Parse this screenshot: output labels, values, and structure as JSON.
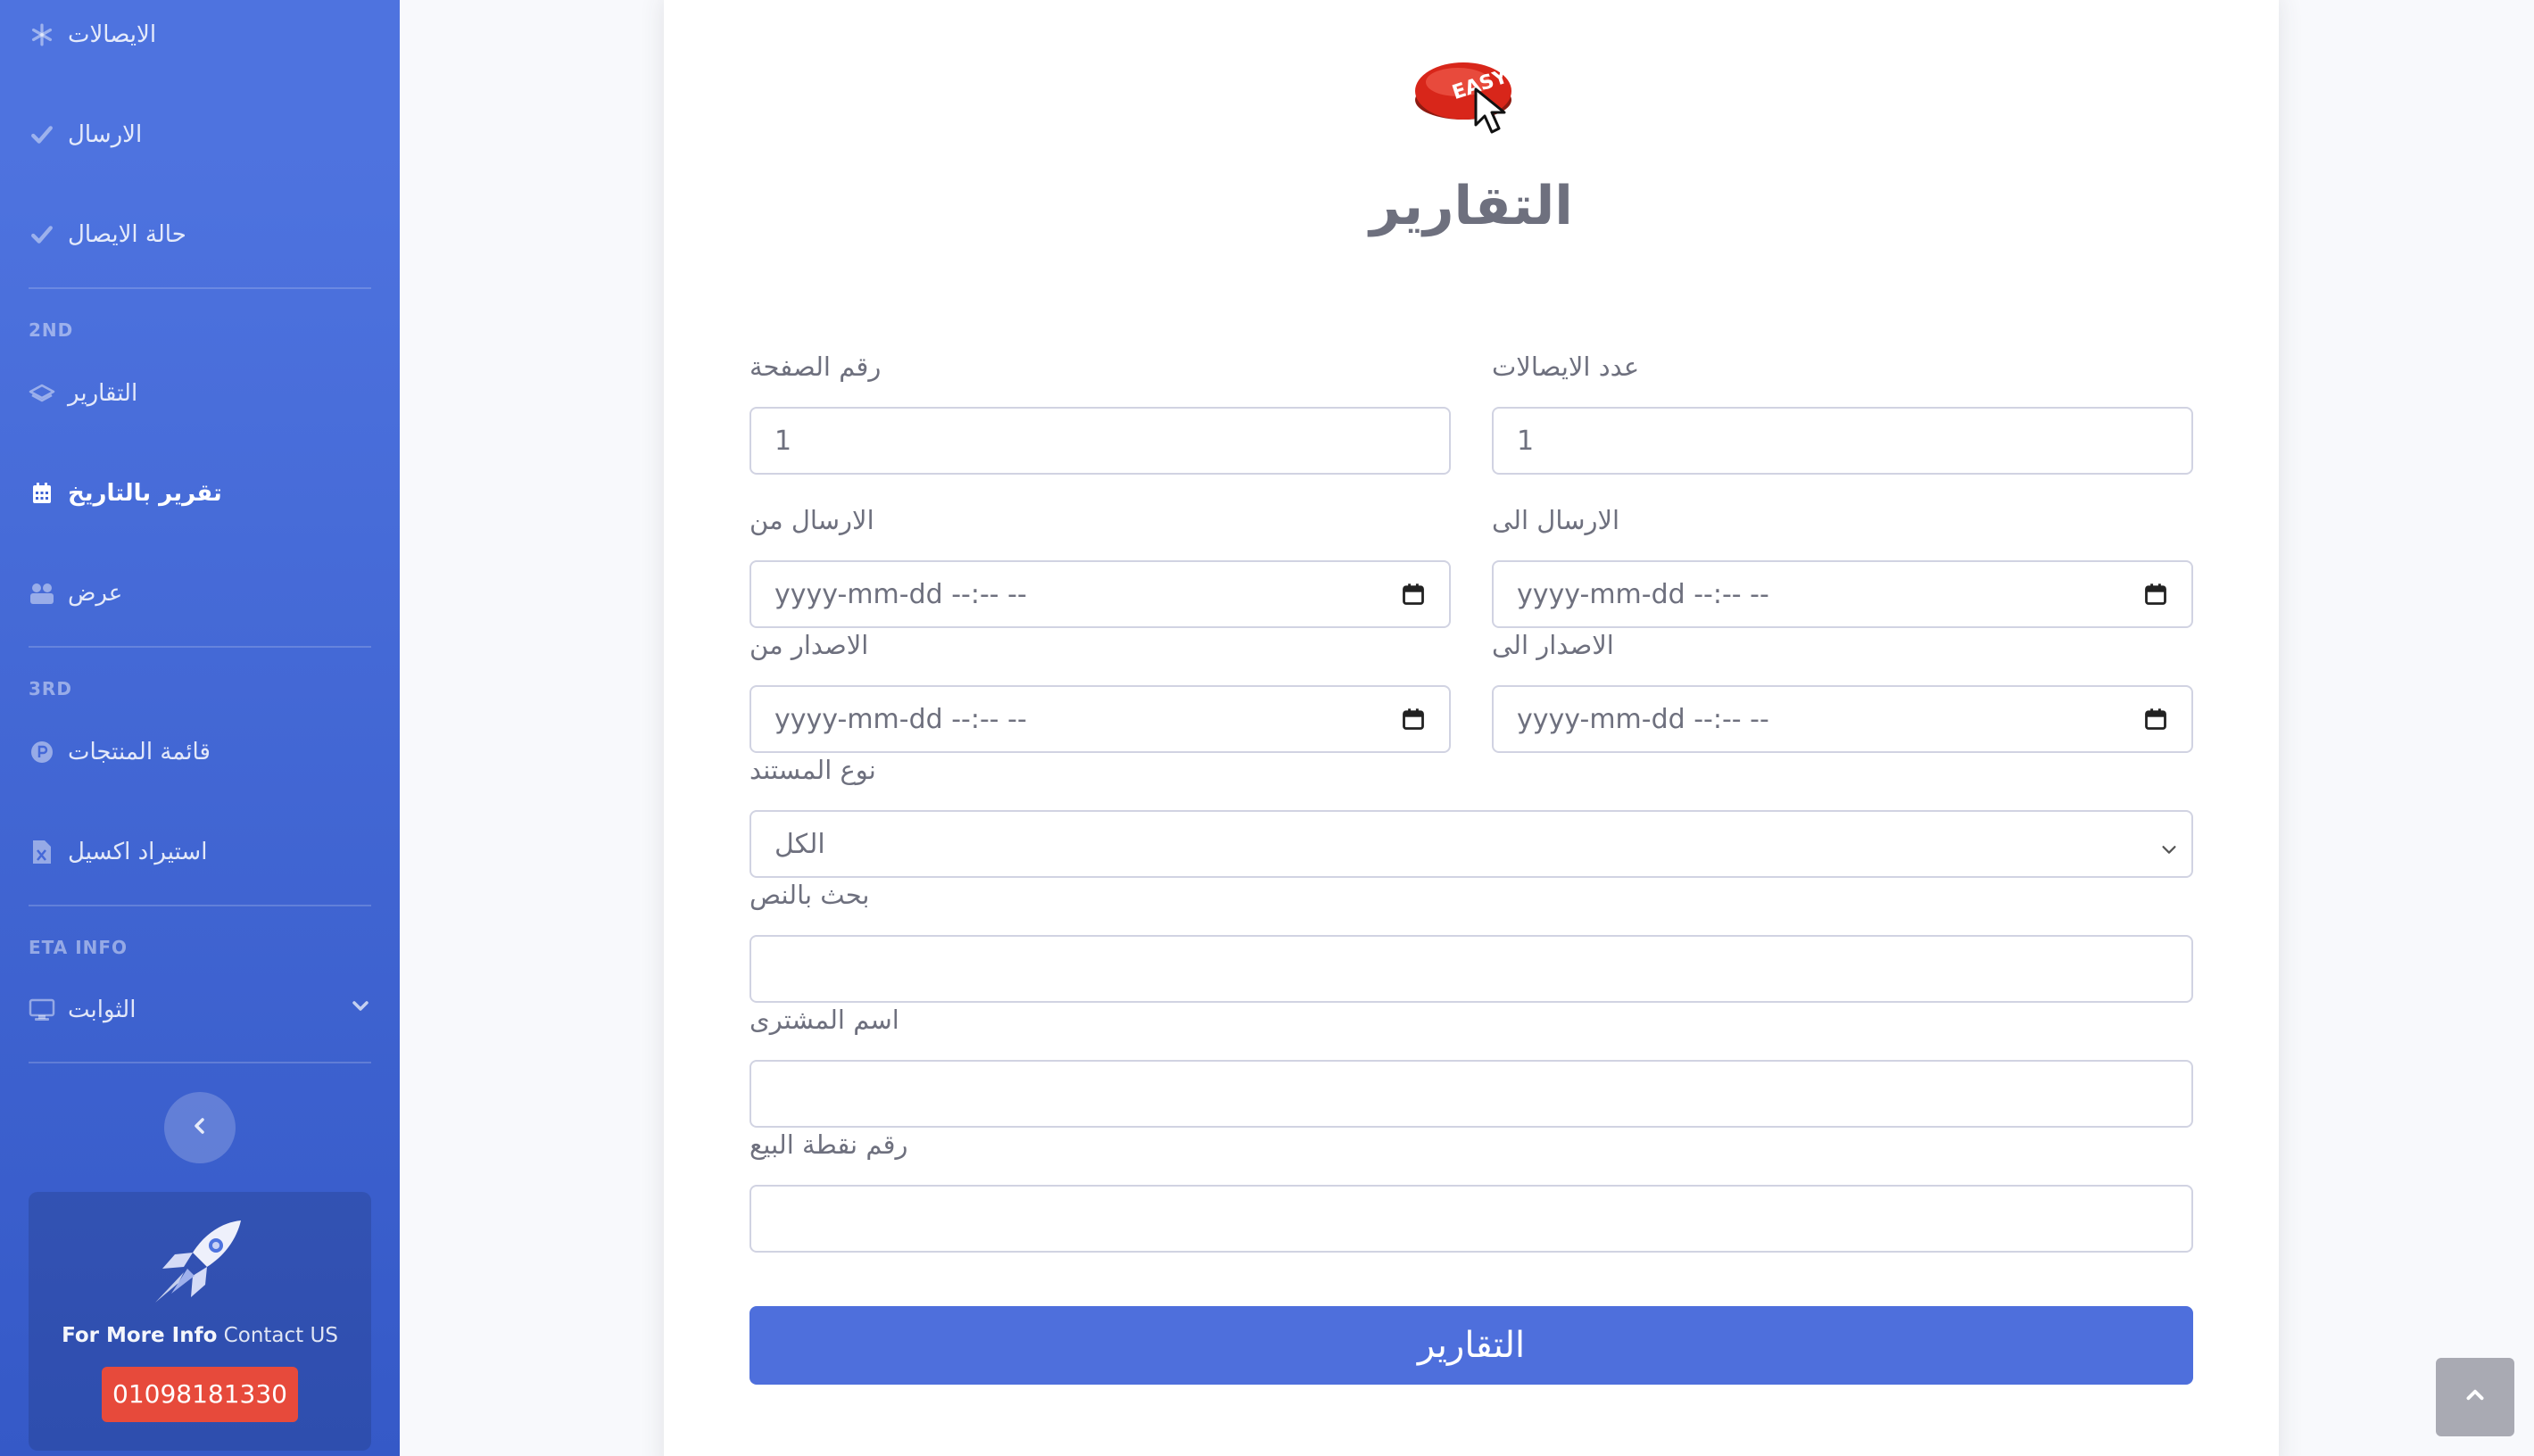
{
  "sidebar": {
    "items": [
      {
        "label": "الايصالات",
        "icon": "asterisk-icon"
      },
      {
        "label": "الارسال",
        "icon": "check-icon"
      },
      {
        "label": "حالة الايصال",
        "icon": "check-icon"
      },
      {
        "label": "التقارير",
        "icon": "layers-icon"
      },
      {
        "label": "تقرير بالتاريخ",
        "icon": "calendar-icon",
        "active": true
      },
      {
        "label": "عرض",
        "icon": "users-icon"
      },
      {
        "label": "قائمة المنتجات",
        "icon": "product-hunt-icon"
      },
      {
        "label": "استيراد اكسيل",
        "icon": "file-excel-icon"
      },
      {
        "label": "الثوابت",
        "icon": "desktop-icon"
      }
    ],
    "headings": [
      "2ND",
      "3RD",
      "ETA INFO"
    ],
    "promo": {
      "bold": "For More Info",
      "text": " Contact US",
      "phone": "01098181330"
    }
  },
  "logo": {
    "text": "EASY"
  },
  "page": {
    "title": "التقارير"
  },
  "form": {
    "receipts_count": {
      "label": "عدد الايصالات",
      "value": "1"
    },
    "page_number": {
      "label": "رقم الصفحة",
      "value": "1"
    },
    "sent_to": {
      "label": "الارسال الى",
      "placeholder": "yyyy-mm-dd --:-- --"
    },
    "sent_from": {
      "label": "الارسال من",
      "placeholder": "yyyy-mm-dd --:-- --"
    },
    "issued_to": {
      "label": "الاصدار الى",
      "placeholder": "yyyy-mm-dd --:-- --"
    },
    "issued_from": {
      "label": "الاصدار من",
      "placeholder": "yyyy-mm-dd --:-- --"
    },
    "doc_type": {
      "label": "نوع المستند",
      "value": "الكل"
    },
    "text_search": {
      "label": "بحث بالنص"
    },
    "buyer_name": {
      "label": "اسم المشترى"
    },
    "pos_number": {
      "label": "رقم نقطة البيع"
    },
    "submit_label": "التقارير"
  },
  "colors": {
    "sidebar": "#4e73df",
    "primary": "#4e6fdc",
    "danger": "#e74a3b"
  }
}
